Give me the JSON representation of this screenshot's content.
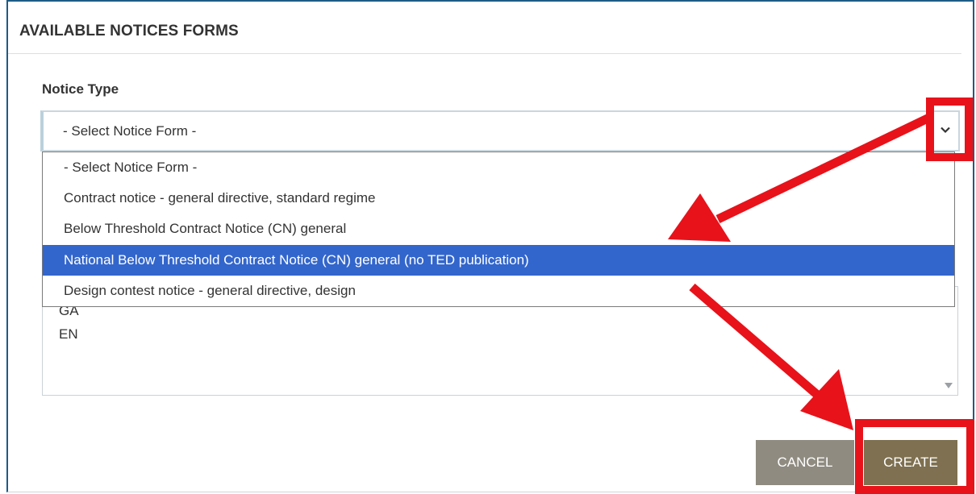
{
  "dialog": {
    "title": "AVAILABLE NOTICES FORMS"
  },
  "notice_type": {
    "label": "Notice Type",
    "selected_value": "- Select Notice Form -",
    "options": [
      "- Select Notice Form -",
      "Contract notice - general directive, standard regime",
      "Below Threshold Contract Notice (CN) general",
      "National Below Threshold Contract Notice (CN) general (no TED publication)",
      "Design contest notice - general directive, design"
    ],
    "highlighted_index": 3
  },
  "languages": {
    "items": [
      "GA",
      "EN"
    ]
  },
  "buttons": {
    "cancel": "CANCEL",
    "create": "CREATE"
  },
  "colors": {
    "highlight": "#3366cc",
    "annotation": "#e8121a",
    "cancel_bg": "#8f8b80",
    "create_bg": "#7e7050"
  }
}
